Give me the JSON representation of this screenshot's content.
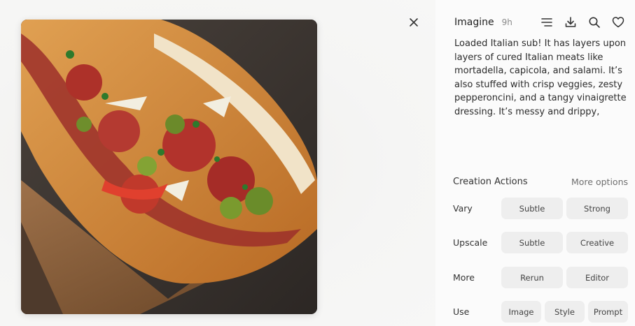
{
  "panel": {
    "title": "Imagine",
    "age": "9h",
    "icons": [
      "list-icon",
      "download-icon",
      "search-icon",
      "heart-icon"
    ],
    "prompt": "Loaded Italian sub! It has layers upon layers of cured Italian meats like mortadella, capicola, and salami. It’s also stuffed with crisp veggies, zesty pepperoncini, and a tangy vinaigrette dressing. It’s messy and drippy,"
  },
  "actions": {
    "title": "Creation Actions",
    "more_options": "More options",
    "rows": [
      {
        "label": "Vary",
        "buttons": [
          "Subtle",
          "Strong"
        ]
      },
      {
        "label": "Upscale",
        "buttons": [
          "Subtle",
          "Creative"
        ]
      },
      {
        "label": "More",
        "buttons": [
          "Rerun",
          "Editor"
        ]
      },
      {
        "label": "Use",
        "buttons": [
          "Image",
          "Style",
          "Prompt"
        ]
      }
    ]
  },
  "colors": {
    "panel_bg": "#fbfbfb",
    "button_bg": "#eeeeee",
    "stage_bg": "#f3f3f2"
  }
}
